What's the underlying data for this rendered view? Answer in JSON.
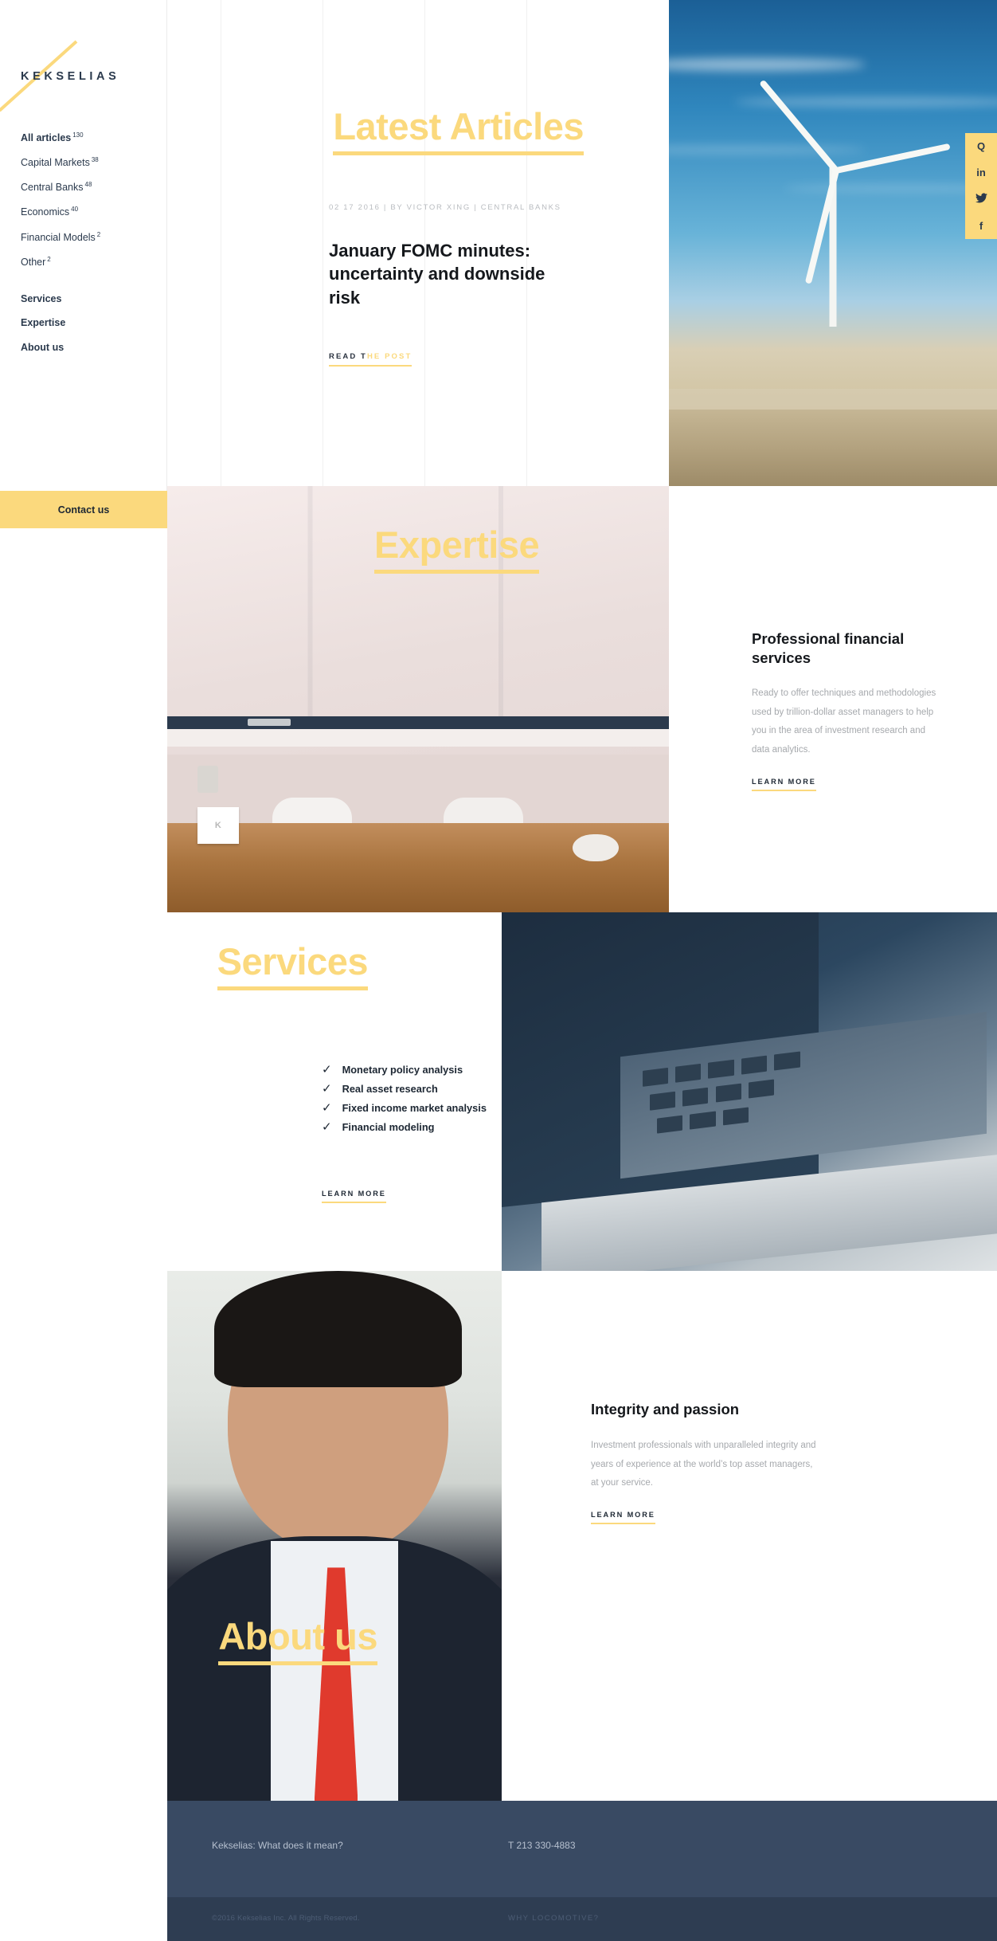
{
  "brand": {
    "name": "KEKSELIAS"
  },
  "sidebar": {
    "categories": [
      {
        "label": "All articles",
        "count": "130",
        "bold": true
      },
      {
        "label": "Capital Markets",
        "count": "38",
        "bold": false
      },
      {
        "label": "Central Banks",
        "count": "48",
        "bold": false
      },
      {
        "label": "Economics",
        "count": "40",
        "bold": false
      },
      {
        "label": "Financial Models",
        "count": "2",
        "bold": false
      },
      {
        "label": "Other",
        "count": "2",
        "bold": false
      }
    ],
    "sections": [
      {
        "label": "Services"
      },
      {
        "label": "Expertise"
      },
      {
        "label": "About us"
      }
    ],
    "contact_label": "Contact us"
  },
  "hero": {
    "title": "Latest Articles",
    "meta": "02 17 2016 | BY VICTOR XING | CENTRAL BANKS",
    "article_title": "January FOMC minutes: uncertainty and downside risk",
    "read_link_dark": "READ T",
    "read_link_yellow": "HE POST",
    "social": [
      {
        "name": "quora-icon",
        "glyph": "Q"
      },
      {
        "name": "linkedin-icon",
        "glyph": "in"
      },
      {
        "name": "twitter-icon",
        "glyph": "✈"
      },
      {
        "name": "facebook-icon",
        "glyph": "f"
      }
    ]
  },
  "expertise": {
    "title": "Expertise",
    "heading": "Professional financial services",
    "body": "Ready to offer techniques and methodologies used by trillion-dollar asset managers to help you in the area of investment research and data analytics.",
    "learn_more": "LEARN MORE",
    "card_initial": "K"
  },
  "services": {
    "title": "Services",
    "items": [
      "Monetary policy analysis",
      "Real asset research",
      "Fixed income market analysis",
      "Financial modeling"
    ],
    "check_glyph": "✓",
    "learn_more": "LEARN MORE"
  },
  "about": {
    "title": "About us",
    "heading": "Integrity and passion",
    "body": "Investment professionals with unparalleled integrity and years of experience at the world’s top asset managers,\nat your service.",
    "learn_more": "LEARN MORE"
  },
  "footer": {
    "link_meaning": "Kekselias: What does it mean?",
    "phone": "T 213 330-4883",
    "copyright": "©2016 Kekselias Inc. All Rights Reserved.",
    "why": "WHY LOCOMOTIVE?"
  },
  "colors": {
    "accent_yellow": "#fbd97d",
    "navy": "#2b3a4d",
    "footer_bg": "#394a63",
    "footer_bottom_bg": "#2e3d52",
    "muted_text": "#a6a9ad"
  }
}
